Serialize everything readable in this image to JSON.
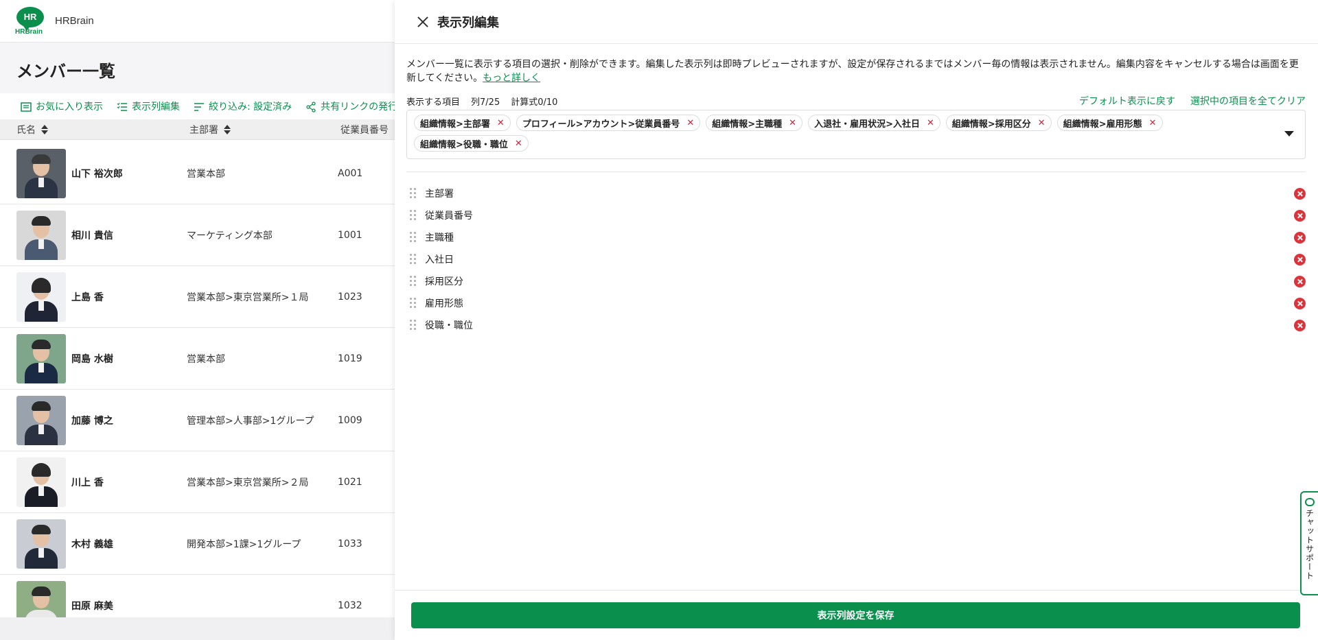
{
  "app": {
    "logo_text": "HR",
    "logo_sub": "HRBrain",
    "name": "HRBrain"
  },
  "page": {
    "title": "メンバー一覧"
  },
  "toolbar": {
    "favorites": "お気に入り表示",
    "column_edit": "表示列編集",
    "filter": "絞り込み: 設定済み",
    "share": "共有リンクの発行"
  },
  "table": {
    "headers": {
      "name": "氏名",
      "dept": "主部署",
      "emp_no": "従業員番号"
    },
    "rows": [
      {
        "name": "山下 裕次郎",
        "dept": "営業本部",
        "emp_no": "A001"
      },
      {
        "name": "相川 貴信",
        "dept": "マーケティング本部",
        "emp_no": "1001"
      },
      {
        "name": "上島 香",
        "dept": "営業本部>東京営業所>１局",
        "emp_no": "1023"
      },
      {
        "name": "岡島 水樹",
        "dept": "営業本部",
        "emp_no": "1019"
      },
      {
        "name": "加藤 博之",
        "dept": "管理本部>人事部>1グループ",
        "emp_no": "1009"
      },
      {
        "name": "川上 香",
        "dept": "営業本部>東京営業所>２局",
        "emp_no": "1021"
      },
      {
        "name": "木村 義雄",
        "dept": "開発本部>1課>1グループ",
        "emp_no": "1033"
      },
      {
        "name": "田原 麻美",
        "dept": "",
        "emp_no": "1032"
      }
    ]
  },
  "panel": {
    "title": "表示列編集",
    "description": "メンバー一覧に表示する項目の選択・削除ができます。編集した表示列は即時プレビューされますが、設定が保存されるまではメンバー毎の情報は表示されません。編集内容をキャンセルする場合は画面を更新してください。",
    "more_link": "もっと詳しく",
    "items_label": "表示する項目",
    "col_count": "列7/25",
    "formula_count": "計算式0/10",
    "reset_default": "デフォルト表示に戻す",
    "clear_all": "選択中の項目を全てクリア",
    "tags": [
      "組織情報>主部署",
      "プロフィール>アカウント>従業員番号",
      "組織情報>主職種",
      "入退社・雇用状況>入社日",
      "組織情報>採用区分",
      "組織情報>雇用形態",
      "組織情報>役職・職位"
    ],
    "columns": [
      "主部署",
      "従業員番号",
      "主職種",
      "入社日",
      "採用区分",
      "雇用形態",
      "役職・職位"
    ],
    "save_button": "表示列設定を保存",
    "chat_support": "チャットサポート"
  },
  "colors": {
    "brand": "#0a8f4d",
    "danger": "#d9343b"
  }
}
